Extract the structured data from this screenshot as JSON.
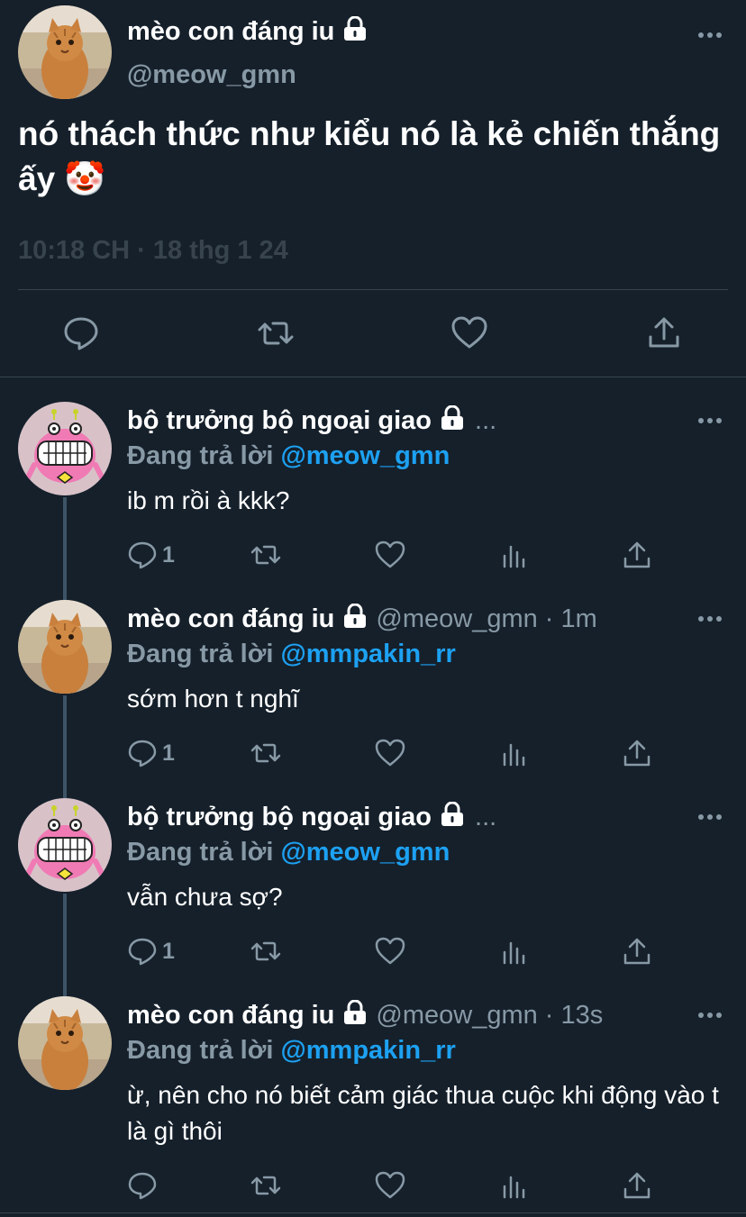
{
  "main_tweet": {
    "author_name": "mèo con đáng iu",
    "handle": "@meow_gmn",
    "text": "nó thách thức như kiểu nó là kẻ chiến thắng ấy 🤡",
    "time": "10:18 CH · 18 thg 1 24",
    "avatar_icon": "cat-avatar-icon",
    "locked": true
  },
  "replies": [
    {
      "author_name": "bộ trưởng bộ ngoại giao",
      "handle": "",
      "name_suffix": "...",
      "reply_prefix": "Đang trả lời",
      "reply_to": "@meow_gmn",
      "text": "ib m rồi à kkk?",
      "reply_count": "1",
      "avatar_icon": "pink-monster-avatar-icon"
    },
    {
      "author_name": "mèo con đáng iu",
      "handle": "@meow_gmn · 1m",
      "name_suffix": "",
      "reply_prefix": "Đang trả lời",
      "reply_to": "@mmpakin_rr",
      "text": "sớm hơn t nghĩ",
      "reply_count": "1",
      "avatar_icon": "cat-avatar-icon"
    },
    {
      "author_name": "bộ trưởng bộ ngoại giao",
      "handle": "",
      "name_suffix": "...",
      "reply_prefix": "Đang trả lời",
      "reply_to": "@meow_gmn",
      "text": "vẫn chưa sợ?",
      "reply_count": "1",
      "avatar_icon": "pink-monster-avatar-icon"
    },
    {
      "author_name": "mèo con đáng iu",
      "handle": "@meow_gmn · 13s",
      "name_suffix": "",
      "reply_prefix": "Đang trả lời",
      "reply_to": "@mmpakin_rr",
      "text": "ừ, nên cho nó biết cảm giác thua cuộc khi động vào t là gì thôi",
      "reply_count": "",
      "avatar_icon": "cat-avatar-icon"
    }
  ],
  "colors": {
    "background": "#15202b",
    "divider": "#38444d",
    "secondary_text": "#8899a6",
    "link": "#1da1f2",
    "thread_line": "#3d5466"
  }
}
